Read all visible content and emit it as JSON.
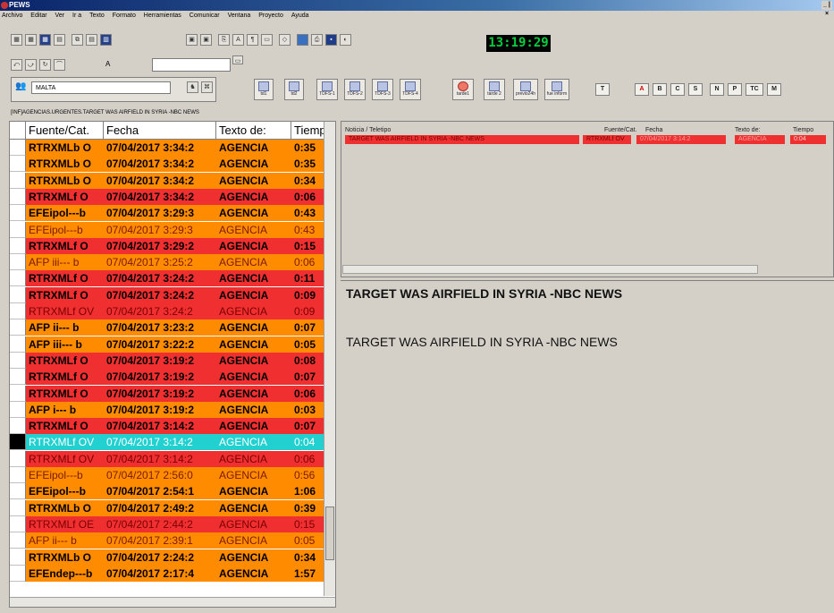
{
  "window": {
    "title": "PEWS",
    "controls": "_ | ×"
  },
  "menu": [
    "Archivo",
    "Editar",
    "Ver",
    "Ir a",
    "Texto",
    "Formato",
    "Herramientas",
    "Comunicar",
    "Ventana",
    "Proyecto",
    "Ayuda"
  ],
  "clock": "13:19:29",
  "search": {
    "value": "MALTA",
    "font_label": "A"
  },
  "toolbar3": [
    {
      "label": "td1"
    },
    {
      "label": "td2"
    },
    {
      "label": "TDFS-1"
    },
    {
      "label": "TDFS-2"
    },
    {
      "label": "TDFS-3"
    },
    {
      "label": "TDFS-4"
    },
    {
      "label": "tarde1"
    },
    {
      "label": "tarde 2"
    },
    {
      "label": "previo24h"
    },
    {
      "label": "fue inform"
    }
  ],
  "smallbuttons": [
    "T",
    "A",
    "B",
    "C",
    "S",
    "N",
    "P",
    "TC",
    "M"
  ],
  "breadcrumb": "[INF]AGENCIAS.URGENTES.TARGET WAS AIRFIELD IN SYRIA -NBC NEWS",
  "colors": {
    "orange": "#ff8c00",
    "red": "#f03030",
    "cyan": "#22d0d0"
  },
  "list": {
    "headers": [
      "Fuente/Cat.",
      "Fecha",
      "Texto de:",
      "Tiemp"
    ],
    "rows": [
      {
        "source": "RTRXMLb O",
        "date": "07/04/2017 3:34:2",
        "text": "AGENCIA",
        "time": "0:35",
        "color": "orange",
        "fg": "#000",
        "bold": true
      },
      {
        "source": "RTRXMLb O",
        "date": "07/04/2017 3:34:2",
        "text": "AGENCIA",
        "time": "0:35",
        "color": "orange",
        "fg": "#000",
        "bold": true
      },
      {
        "source": "RTRXMLb O",
        "date": "07/04/2017 3:34:2",
        "text": "AGENCIA",
        "time": "0:34",
        "color": "orange",
        "fg": "#000",
        "bold": true
      },
      {
        "source": "RTRXMLf O",
        "date": "07/04/2017 3:34:2",
        "text": "AGENCIA",
        "time": "0:06",
        "color": "red",
        "fg": "#000",
        "bold": true
      },
      {
        "source": "EFEipol---b",
        "date": "07/04/2017 3:29:3",
        "text": "AGENCIA",
        "time": "0:43",
        "color": "orange",
        "fg": "#000",
        "bold": true
      },
      {
        "source": "EFEipol---b",
        "date": "07/04/2017 3:29:3",
        "text": "AGENCIA",
        "time": "0:43",
        "color": "orange",
        "fg": "#7a1a00",
        "bold": false
      },
      {
        "source": "RTRXMLf O",
        "date": "07/04/2017 3:29:2",
        "text": "AGENCIA",
        "time": "0:15",
        "color": "red",
        "fg": "#000",
        "bold": true
      },
      {
        "source": "AFP iii--- b",
        "date": "07/04/2017 3:25:2",
        "text": "AGENCIA",
        "time": "0:06",
        "color": "orange",
        "fg": "#7a1a00",
        "bold": false
      },
      {
        "source": "RTRXMLf O",
        "date": "07/04/2017 3:24:2",
        "text": "AGENCIA",
        "time": "0:11",
        "color": "red",
        "fg": "#000",
        "bold": true
      },
      {
        "source": "RTRXMLf O",
        "date": "07/04/2017 3:24:2",
        "text": "AGENCIA",
        "time": "0:09",
        "color": "red",
        "fg": "#000",
        "bold": true
      },
      {
        "source": "RTRXMLf OV",
        "date": "07/04/2017 3:24:2",
        "text": "AGENCIA",
        "time": "0:09",
        "color": "red",
        "fg": "#7a0000",
        "bold": false
      },
      {
        "source": "AFP ii--- b",
        "date": "07/04/2017 3:23:2",
        "text": "AGENCIA",
        "time": "0:07",
        "color": "orange",
        "fg": "#000",
        "bold": true
      },
      {
        "source": "AFP iii--- b",
        "date": "07/04/2017 3:22:2",
        "text": "AGENCIA",
        "time": "0:05",
        "color": "orange",
        "fg": "#000",
        "bold": true
      },
      {
        "source": "RTRXMLf O",
        "date": "07/04/2017 3:19:2",
        "text": "AGENCIA",
        "time": "0:08",
        "color": "red",
        "fg": "#000",
        "bold": true
      },
      {
        "source": "RTRXMLf O",
        "date": "07/04/2017 3:19:2",
        "text": "AGENCIA",
        "time": "0:07",
        "color": "red",
        "fg": "#000",
        "bold": true
      },
      {
        "source": "RTRXMLf O",
        "date": "07/04/2017 3:19:2",
        "text": "AGENCIA",
        "time": "0:06",
        "color": "red",
        "fg": "#000",
        "bold": true
      },
      {
        "source": "AFP i--- b",
        "date": "07/04/2017 3:19:2",
        "text": "AGENCIA",
        "time": "0:03",
        "color": "orange",
        "fg": "#000",
        "bold": true
      },
      {
        "source": "RTRXMLf O",
        "date": "07/04/2017 3:14:2",
        "text": "AGENCIA",
        "time": "0:07",
        "color": "red",
        "fg": "#000",
        "bold": true
      },
      {
        "source": "RTRXMLf OV",
        "date": "07/04/2017 3:14:2",
        "text": "AGENCIA",
        "time": "0:04",
        "color": "cyan",
        "fg": "#ffffff",
        "bold": false,
        "selected": true
      },
      {
        "source": "RTRXMLf OV",
        "date": "07/04/2017 3:14:2",
        "text": "AGENCIA",
        "time": "0:06",
        "color": "red",
        "fg": "#7a0000",
        "bold": false
      },
      {
        "source": "EFEipol---b",
        "date": "07/04/2017 2:56:0",
        "text": "AGENCIA",
        "time": "0:56",
        "color": "orange",
        "fg": "#7a1a00",
        "bold": false
      },
      {
        "source": "EFEipol---b",
        "date": "07/04/2017 2:54:1",
        "text": "AGENCIA",
        "time": "1:06",
        "color": "orange",
        "fg": "#000",
        "bold": true
      },
      {
        "source": "RTRXMLb O",
        "date": "07/04/2017 2:49:2",
        "text": "AGENCIA",
        "time": "0:39",
        "color": "orange",
        "fg": "#000",
        "bold": true
      },
      {
        "source": "RTRXMLf OE",
        "date": "07/04/2017 2:44:2",
        "text": "AGENCIA",
        "time": "0:15",
        "color": "red",
        "fg": "#7a0000",
        "bold": false
      },
      {
        "source": "AFP ii--- b",
        "date": "07/04/2017 2:39:1",
        "text": "AGENCIA",
        "time": "0:05",
        "color": "orange",
        "fg": "#7a1a00",
        "bold": false
      },
      {
        "source": "RTRXMLb O",
        "date": "07/04/2017 2:24:2",
        "text": "AGENCIA",
        "time": "0:34",
        "color": "orange",
        "fg": "#000",
        "bold": true
      },
      {
        "source": "EFEndep---b",
        "date": "07/04/2017 2:17:4",
        "text": "AGENCIA",
        "time": "1:57",
        "color": "orange",
        "fg": "#000",
        "bold": true
      }
    ]
  },
  "detail": {
    "headers": [
      "Noticia / Teletipo",
      "Fuente/Cat.",
      "Fecha",
      "Texto de:",
      "Tiempo"
    ],
    "row": {
      "title": "TARGET WAS AIRFIELD IN SYRIA -NBC NEWS",
      "source": "RTRXMLf OV",
      "date": "07/04/2017 3:14:2",
      "text": "AGENCIA",
      "time": "0:04"
    }
  },
  "story": {
    "headline": "TARGET WAS AIRFIELD IN SYRIA -NBC NEWS",
    "body": "TARGET WAS AIRFIELD IN SYRIA -NBC NEWS"
  }
}
